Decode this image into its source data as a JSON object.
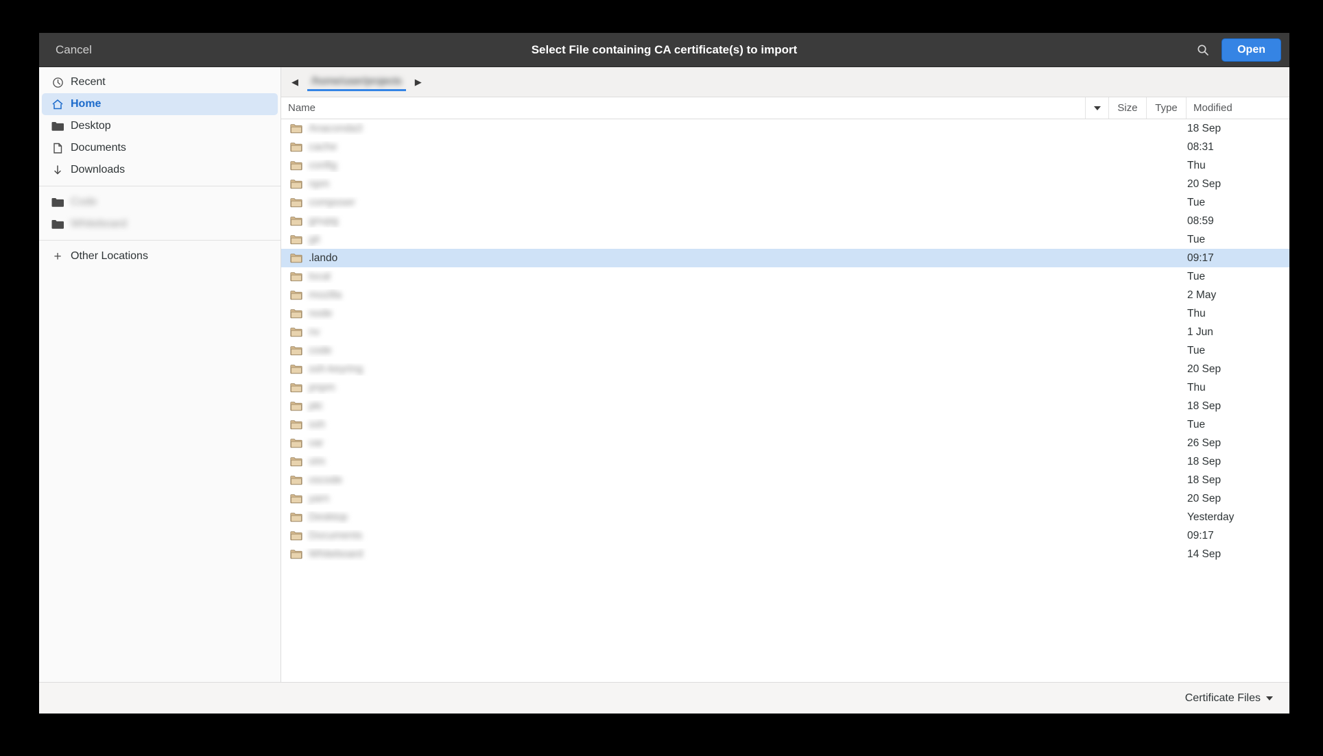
{
  "header": {
    "cancel_label": "Cancel",
    "title": "Select File containing CA certificate(s) to import",
    "open_label": "Open",
    "search_icon": "search-icon",
    "accent_color": "#3584e4"
  },
  "sidebar": {
    "items": [
      {
        "label": "Recent",
        "icon": "clock-icon",
        "selected": false,
        "blurred": false
      },
      {
        "label": "Home",
        "icon": "home-icon",
        "selected": true,
        "blurred": false
      },
      {
        "label": "Desktop",
        "icon": "folder-icon",
        "selected": false,
        "blurred": false
      },
      {
        "label": "Documents",
        "icon": "document-icon",
        "selected": false,
        "blurred": false
      },
      {
        "label": "Downloads",
        "icon": "download-icon",
        "selected": false,
        "blurred": false
      }
    ],
    "bookmarks": [
      {
        "label": "Code",
        "icon": "folder-icon",
        "blurred": true
      },
      {
        "label": "Whiteboard",
        "icon": "folder-icon",
        "blurred": true
      }
    ],
    "other_locations": {
      "label": "Other Locations",
      "icon": "plus-icon"
    }
  },
  "pathbar": {
    "back_icon": "chevron-left-icon",
    "forward_icon": "chevron-right-icon",
    "current_crumb": "/home/user/projects",
    "crumb_blurred": true
  },
  "columns": {
    "name": "Name",
    "sort_icon": "chevron-down-icon",
    "size": "Size",
    "type": "Type",
    "modified": "Modified"
  },
  "files": [
    {
      "name": "Anaconda3",
      "size": "",
      "type": "",
      "modified": "18 Sep",
      "icon": "folder-icon",
      "blurred": true,
      "selected": false
    },
    {
      "name": "cache",
      "size": "",
      "type": "",
      "modified": "08:31",
      "icon": "folder-icon",
      "blurred": true,
      "selected": false
    },
    {
      "name": "config",
      "size": "",
      "type": "",
      "modified": "Thu",
      "icon": "folder-icon",
      "blurred": true,
      "selected": false
    },
    {
      "name": "npm",
      "size": "",
      "type": "",
      "modified": "20 Sep",
      "icon": "folder-icon",
      "blurred": true,
      "selected": false
    },
    {
      "name": "composer",
      "size": "",
      "type": "",
      "modified": "Tue",
      "icon": "folder-icon",
      "blurred": true,
      "selected": false
    },
    {
      "name": "gnupg",
      "size": "",
      "type": "",
      "modified": "08:59",
      "icon": "folder-icon",
      "blurred": true,
      "selected": false
    },
    {
      "name": "git",
      "size": "",
      "type": "",
      "modified": "Tue",
      "icon": "folder-icon",
      "blurred": true,
      "selected": false
    },
    {
      "name": ".lando",
      "size": "",
      "type": "",
      "modified": "09:17",
      "icon": "folder-icon",
      "blurred": false,
      "selected": true
    },
    {
      "name": "local",
      "size": "",
      "type": "",
      "modified": "Tue",
      "icon": "folder-icon",
      "blurred": true,
      "selected": false
    },
    {
      "name": "mozilla",
      "size": "",
      "type": "",
      "modified": "2 May",
      "icon": "folder-icon",
      "blurred": true,
      "selected": false
    },
    {
      "name": "node",
      "size": "",
      "type": "",
      "modified": "Thu",
      "icon": "folder-icon",
      "blurred": true,
      "selected": false
    },
    {
      "name": "nv",
      "size": "",
      "type": "",
      "modified": "1 Jun",
      "icon": "folder-icon",
      "blurred": true,
      "selected": false
    },
    {
      "name": "code",
      "size": "",
      "type": "",
      "modified": "Tue",
      "icon": "folder-icon",
      "blurred": true,
      "selected": false
    },
    {
      "name": "ssh-keyring",
      "size": "",
      "type": "",
      "modified": "20 Sep",
      "icon": "folder-icon",
      "blurred": true,
      "selected": false
    },
    {
      "name": "pnpm",
      "size": "",
      "type": "",
      "modified": "Thu",
      "icon": "folder-icon",
      "blurred": true,
      "selected": false
    },
    {
      "name": "pki",
      "size": "",
      "type": "",
      "modified": "18 Sep",
      "icon": "folder-icon",
      "blurred": true,
      "selected": false
    },
    {
      "name": "ssh",
      "size": "",
      "type": "",
      "modified": "Tue",
      "icon": "folder-icon",
      "blurred": true,
      "selected": false
    },
    {
      "name": "var",
      "size": "",
      "type": "",
      "modified": "26 Sep",
      "icon": "folder-icon",
      "blurred": true,
      "selected": false
    },
    {
      "name": "vim",
      "size": "",
      "type": "",
      "modified": "18 Sep",
      "icon": "folder-icon",
      "blurred": true,
      "selected": false
    },
    {
      "name": "vscode",
      "size": "",
      "type": "",
      "modified": "18 Sep",
      "icon": "folder-icon",
      "blurred": true,
      "selected": false
    },
    {
      "name": "yarn",
      "size": "",
      "type": "",
      "modified": "20 Sep",
      "icon": "folder-icon",
      "blurred": true,
      "selected": false
    },
    {
      "name": "Desktop",
      "size": "",
      "type": "",
      "modified": "Yesterday",
      "icon": "folder-icon",
      "blurred": true,
      "selected": false
    },
    {
      "name": "Documents",
      "size": "",
      "type": "",
      "modified": "09:17",
      "icon": "folder-icon",
      "blurred": true,
      "selected": false
    },
    {
      "name": "Whiteboard",
      "size": "",
      "type": "",
      "modified": "14 Sep",
      "icon": "folder-icon",
      "blurred": true,
      "selected": false
    }
  ],
  "bottombar": {
    "filter_label": "Certificate Files",
    "filter_caret_icon": "caret-down-icon"
  }
}
